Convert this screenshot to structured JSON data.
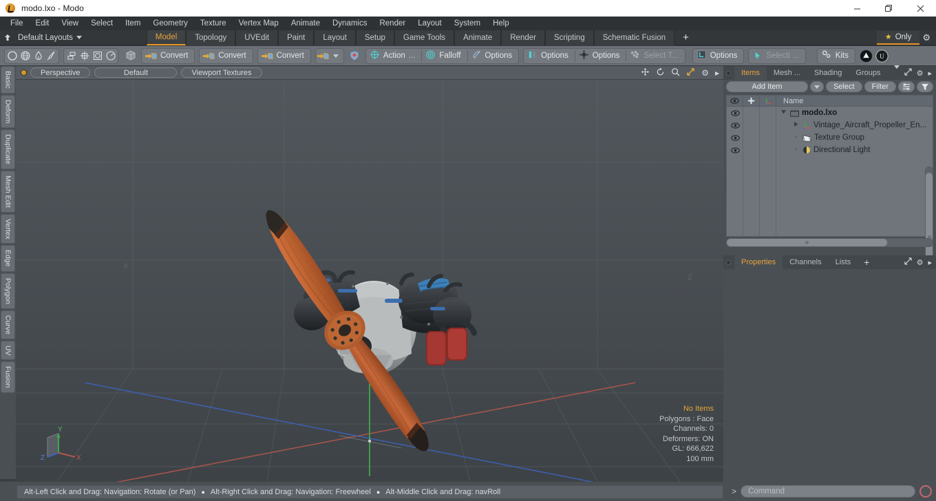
{
  "window": {
    "title": "modo.lxo - Modo",
    "app_icon": "modo-logo-icon",
    "minimize": "minimize-icon",
    "maximize": "maximize-icon",
    "close": "close-icon"
  },
  "menubar": {
    "items": [
      "File",
      "Edit",
      "View",
      "Select",
      "Item",
      "Geometry",
      "Texture",
      "Vertex Map",
      "Animate",
      "Dynamics",
      "Render",
      "Layout",
      "System",
      "Help"
    ]
  },
  "layoutbar": {
    "home_icon": "home-icon",
    "layout_selector": "Default Layouts",
    "tabs": [
      {
        "label": "Model",
        "active": true
      },
      {
        "label": "Topology",
        "active": false
      },
      {
        "label": "UVEdit",
        "active": false
      },
      {
        "label": "Paint",
        "active": false
      },
      {
        "label": "Layout",
        "active": false
      },
      {
        "label": "Setup",
        "active": false
      },
      {
        "label": "Game Tools",
        "active": false
      },
      {
        "label": "Animate",
        "active": false
      },
      {
        "label": "Render",
        "active": false
      },
      {
        "label": "Scripting",
        "active": false
      },
      {
        "label": "Schematic Fusion",
        "active": false
      }
    ],
    "add_tab": "+",
    "only_label": "Only",
    "only_star": "star-icon",
    "settings_icon": "gear-icon"
  },
  "toolstrip": {
    "primitive_group": [
      "sphere-icon",
      "globe-icon",
      "teardrop-icon",
      "brush-icon"
    ],
    "mesh_group": [
      "mesh-stack-icon",
      "mesh-cross-icon",
      "mesh-square-icon",
      "mesh-circle-icon"
    ],
    "cube_icon": "cube-icon",
    "convert_buttons": [
      "Convert",
      "Convert",
      "Convert"
    ],
    "convert_icon": "convert-cube-icon",
    "dropdown_icon": "chevron-down-icon",
    "shield_icon": "shield-icon",
    "action_label": "Action",
    "action_ellipsis": "...",
    "action_icon": "action-center-icon",
    "falloff_label": "Falloff",
    "falloff_icon": "falloff-icon",
    "options_1": "Options",
    "options_1_icon": "snap-options-icon",
    "options_2": "Options",
    "options_2_icon": "symmetry-icon",
    "options_3": "Options",
    "options_3_icon": "workplane-icon",
    "select_through": "Select T...",
    "select_through_icon": "select-through-icon",
    "options_4": "Options",
    "options_4_icon": "grid-options-icon",
    "selection_label": "Selecti ...",
    "selection_icon": "selection-arrow-icon",
    "kits_label": "Kits",
    "kits_icon": "gears-icon",
    "modo_badge": "modo-badge-icon",
    "unreal_badge": "unreal-badge-icon"
  },
  "left_rail": {
    "tabs": [
      "Basic",
      "Deform",
      "Duplicate",
      "Mesh Edit",
      "Vertex",
      "Edge",
      "Polygon",
      "Curve",
      "UV",
      "Fusion"
    ]
  },
  "viewport": {
    "indicator": "viewport-active-dot",
    "view_mode": "Perspective",
    "shading_preset": "Default",
    "texture_mode": "Viewport Textures",
    "tools": [
      "pan-icon",
      "rotate-icon",
      "zoom-icon",
      "fit-icon",
      "gear-icon",
      "play-arrow-icon"
    ],
    "axis_labels": {
      "x": "X",
      "y": "Y",
      "z": "Z"
    },
    "gizmo_labels": {
      "x": "X",
      "y": "Y",
      "z": "Z"
    },
    "info": {
      "selection": "No Items",
      "polygons": "Polygons : Face",
      "channels": "Channels: 0",
      "deformers": "Deformers: ON",
      "gl": "GL: 666,622",
      "grid": "100 mm"
    },
    "model": "vintage aircraft propeller engine with wooden two-blade propeller"
  },
  "right_panel": {
    "tabs": [
      {
        "label": "Items",
        "active": true
      },
      {
        "label": "Mesh ...",
        "active": false
      },
      {
        "label": "Shading",
        "active": false
      },
      {
        "label": "Groups",
        "active": false
      }
    ],
    "tab_overflow_icon": "chevron-down-icon",
    "expand_icon": "expand-icon",
    "gear_icon": "gear-icon",
    "more_icon": "play-arrow-icon",
    "toolbar": {
      "add_item": "Add Item",
      "add_item_dropdown": "chevron-down-icon",
      "select": "Select",
      "filter": "Filter",
      "list_view_icon": "list-view-icon",
      "funnel_icon": "funnel-icon"
    },
    "tree": {
      "columns": [
        "eye-icon",
        "lock-icon",
        "axis-icon",
        "Name"
      ],
      "rows": [
        {
          "label": "modo.lxo",
          "icon": "scene-icon",
          "depth": 0,
          "expanded": true,
          "bold": true
        },
        {
          "label": "Vintage_Aircraft_Propeller_En...",
          "icon": "mesh-axis-icon",
          "depth": 1,
          "expanded": false,
          "bold": false
        },
        {
          "label": "Texture Group",
          "icon": "texture-group-icon",
          "depth": 1,
          "expanded": null,
          "bold": false
        },
        {
          "label": "Directional Light",
          "icon": "light-icon",
          "depth": 1,
          "expanded": null,
          "bold": false
        }
      ]
    },
    "bottom_tabs": [
      {
        "label": "Properties",
        "active": true
      },
      {
        "label": "Channels",
        "active": false
      },
      {
        "label": "Lists",
        "active": false
      }
    ],
    "bottom_add_tab": "+"
  },
  "statusbar": {
    "hints": [
      "Alt-Left Click and Drag: Navigation: Rotate (or Pan)",
      "Alt-Right Click and Drag: Navigation: Freewheel",
      "Alt-Middle Click and Drag: navRoll"
    ],
    "separator": "●"
  },
  "command_bar": {
    "prompt": ">",
    "placeholder": "Command",
    "value": "",
    "record_button": "record-icon"
  },
  "colors": {
    "accent": "#e8a33d",
    "toolstrip_bg": "#6a7076",
    "panel_bg": "#4a4f54",
    "viewport_bg": "#474c51",
    "x_axis": "#c4584f",
    "y_axis": "#4cae4c",
    "z_axis": "#4a6fd0"
  }
}
